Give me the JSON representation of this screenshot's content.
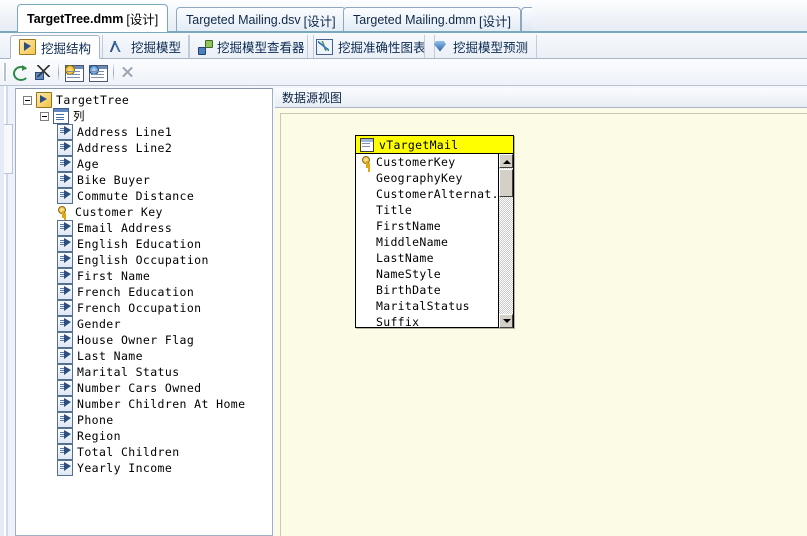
{
  "window": {
    "doc_tabs": [
      {
        "label": "TargetTree.dmm",
        "suffix": "[设计]",
        "active": true
      },
      {
        "label": "Targeted Mailing.dsv",
        "suffix": "[设计]",
        "active": false
      },
      {
        "label": "Targeted Mailing.dmm",
        "suffix": "[设计]",
        "active": false
      }
    ]
  },
  "designer_tabs": [
    {
      "label": "挖掘结构",
      "icon": "mining-structure-icon",
      "active": true
    },
    {
      "label": "挖掘模型",
      "icon": "mining-model-icon",
      "active": false
    },
    {
      "label": "挖掘模型查看器",
      "icon": "mining-model-viewer-icon",
      "active": false
    },
    {
      "label": "挖掘准确性图表",
      "icon": "mining-accuracy-chart-icon",
      "active": false
    },
    {
      "label": "挖掘模型预测",
      "icon": "mining-prediction-icon",
      "active": false
    }
  ],
  "toolbar": {
    "buttons": [
      {
        "name": "refresh-button",
        "icon": "refresh-icon"
      },
      {
        "name": "process-button",
        "icon": "process-icon"
      },
      {
        "name": "add-table-button",
        "icon": "add-table-icon"
      },
      {
        "name": "edit-table-button",
        "icon": "edit-table-icon"
      },
      {
        "name": "delete-button",
        "icon": "close-icon"
      }
    ]
  },
  "tree": {
    "root": {
      "label": "TargetTree",
      "icon": "mining-structure-icon"
    },
    "columns_group": {
      "label": "列",
      "icon": "columns-icon"
    },
    "columns": [
      {
        "label": "Address Line1",
        "icon": "column-icon"
      },
      {
        "label": "Address Line2",
        "icon": "column-icon"
      },
      {
        "label": "Age",
        "icon": "column-icon"
      },
      {
        "label": "Bike Buyer",
        "icon": "column-icon"
      },
      {
        "label": "Commute Distance",
        "icon": "column-icon"
      },
      {
        "label": "Customer Key",
        "icon": "key-icon"
      },
      {
        "label": "Email Address",
        "icon": "column-icon"
      },
      {
        "label": "English Education",
        "icon": "column-icon"
      },
      {
        "label": "English Occupation",
        "icon": "column-icon"
      },
      {
        "label": "First Name",
        "icon": "column-icon"
      },
      {
        "label": "French Education",
        "icon": "column-icon"
      },
      {
        "label": "French Occupation",
        "icon": "column-icon"
      },
      {
        "label": "Gender",
        "icon": "column-icon"
      },
      {
        "label": "House Owner Flag",
        "icon": "column-icon"
      },
      {
        "label": "Last Name",
        "icon": "column-icon"
      },
      {
        "label": "Marital Status",
        "icon": "column-icon"
      },
      {
        "label": "Number Cars Owned",
        "icon": "column-icon"
      },
      {
        "label": "Number Children At Home",
        "icon": "column-icon"
      },
      {
        "label": "Phone",
        "icon": "column-icon"
      },
      {
        "label": "Region",
        "icon": "column-icon"
      },
      {
        "label": "Total Children",
        "icon": "column-icon"
      },
      {
        "label": "Yearly Income",
        "icon": "column-icon"
      }
    ]
  },
  "dsv_pane": {
    "header": "数据源视图",
    "table": {
      "name": "vTargetMail",
      "header_color": "#ffff00",
      "fields": [
        {
          "label": "CustomerKey",
          "key": true
        },
        {
          "label": "GeographyKey",
          "key": false
        },
        {
          "label": "CustomerAlternat...",
          "key": false
        },
        {
          "label": "Title",
          "key": false
        },
        {
          "label": "FirstName",
          "key": false
        },
        {
          "label": "MiddleName",
          "key": false
        },
        {
          "label": "LastName",
          "key": false
        },
        {
          "label": "NameStyle",
          "key": false
        },
        {
          "label": "BirthDate",
          "key": false
        },
        {
          "label": "MaritalStatus",
          "key": false
        },
        {
          "label": "Suffix",
          "key": false
        }
      ]
    }
  },
  "colors": {
    "canvas": "#fbfbe6",
    "table_header": "#ffff00",
    "tab_underline": "#7aa8bd"
  }
}
